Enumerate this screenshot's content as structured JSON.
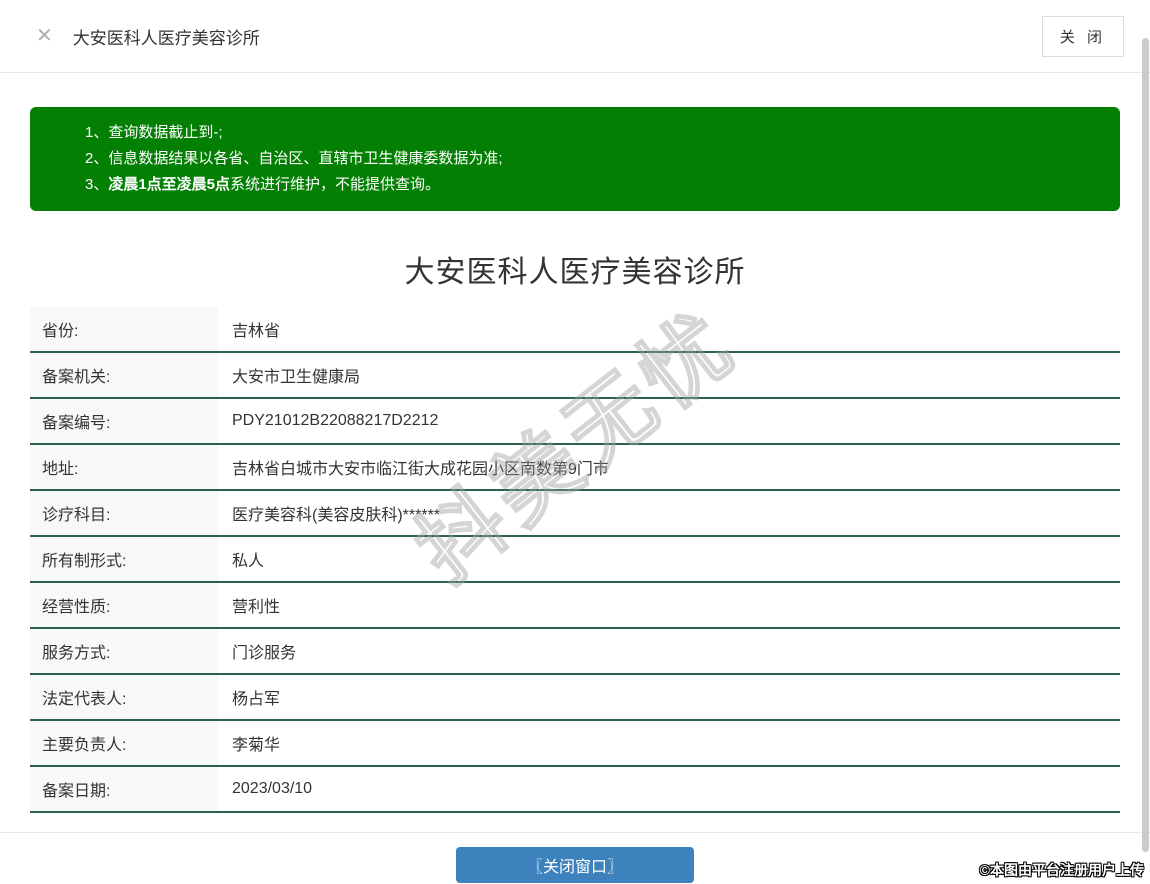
{
  "header": {
    "close_icon": "✕",
    "title": "大安医科人医疗美容诊所",
    "close_button": "关 闭"
  },
  "notice": {
    "items": [
      {
        "num": "1、",
        "bold": "",
        "text": "查询数据截止到-;"
      },
      {
        "num": "2、",
        "bold": "",
        "text": "信息数据结果以各省、自治区、直辖市卫生健康委数据为准;"
      },
      {
        "num": "3、",
        "bold": "凌晨1点至凌晨5点",
        "text": "系统进行维护，不能提供查询。"
      }
    ]
  },
  "detail": {
    "title": "大安医科人医疗美容诊所",
    "rows": [
      {
        "label": "省份:",
        "value": "吉林省"
      },
      {
        "label": "备案机关:",
        "value": "大安市卫生健康局"
      },
      {
        "label": "备案编号:",
        "value": "PDY21012B22088217D2212"
      },
      {
        "label": "地址:",
        "value": "吉林省白城市大安市临江街大成花园小区南数第9门市"
      },
      {
        "label": "诊疗科目:",
        "value": "医疗美容科(美容皮肤科)******"
      },
      {
        "label": "所有制形式:",
        "value": "私人"
      },
      {
        "label": "经营性质:",
        "value": "营利性"
      },
      {
        "label": "服务方式:",
        "value": "门诊服务"
      },
      {
        "label": "法定代表人:",
        "value": "杨占军"
      },
      {
        "label": "主要负责人:",
        "value": "李菊华"
      },
      {
        "label": "备案日期:",
        "value": "2023/03/10"
      }
    ]
  },
  "footer": {
    "close_window_button": "〖关闭窗口〗"
  },
  "watermark": "抖美无忧",
  "copyright": "©本图由平台注册用户上传",
  "colors": {
    "notice_green": "#038003",
    "button_blue": "#3d82bd",
    "divider_teal": "#2a6154"
  }
}
